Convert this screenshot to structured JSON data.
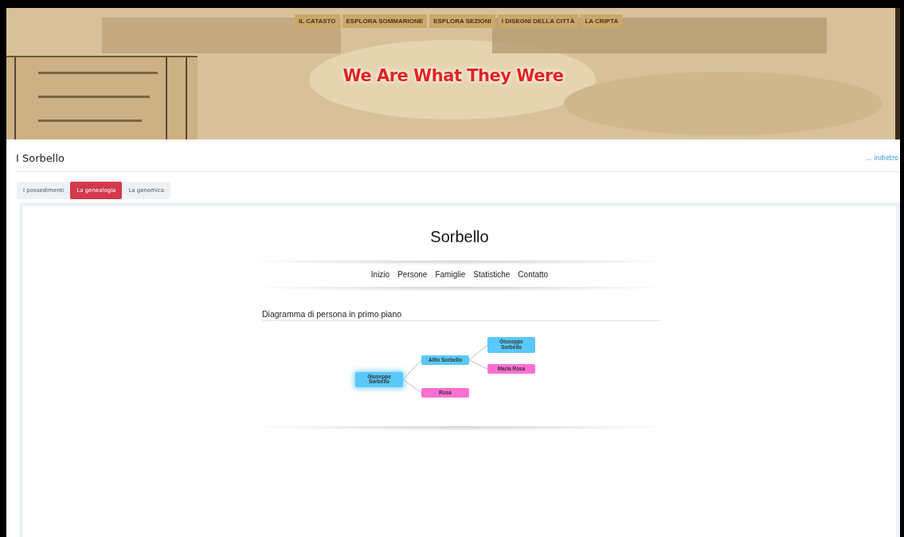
{
  "header": {
    "menu": [
      {
        "label": "IL CATASTO"
      },
      {
        "label": "ESPLORA SOMMARIONE"
      },
      {
        "label": "ESPLORA SEZIONI"
      },
      {
        "label": "I DISEGNI DELLA CITTÀ"
      },
      {
        "label": "LA CRIPTA"
      }
    ],
    "site_title": "We Are What They Were"
  },
  "page": {
    "title": "I Sorbello",
    "back_link": "... indietro"
  },
  "tabs": [
    {
      "label": "I possedimenti",
      "selected": false
    },
    {
      "label": "La genealogia",
      "selected": true
    },
    {
      "label": "La genomica",
      "selected": false
    }
  ],
  "embedded": {
    "title": "Sorbello",
    "nav": [
      "Inizio",
      "Persone",
      "Famiglie",
      "Statistiche",
      "Contatto"
    ],
    "section_title": "Diagramma di persona in primo piano",
    "tree": {
      "name": "Giuseppe Sorbello",
      "color": "#5ac8fa",
      "focus": true,
      "children": [
        {
          "name": "Alfio Sorbello",
          "color": "#5ac8fa",
          "focus": false,
          "children": [
            {
              "name": "Giuseppe Sorbello",
              "color": "#5ac8fa",
              "focus": false
            },
            {
              "name": "Maria Rosa",
              "color": "#ff6fd2",
              "focus": false
            }
          ]
        },
        {
          "name": "Rosa",
          "color": "#ff6fd2",
          "focus": false
        }
      ]
    }
  }
}
